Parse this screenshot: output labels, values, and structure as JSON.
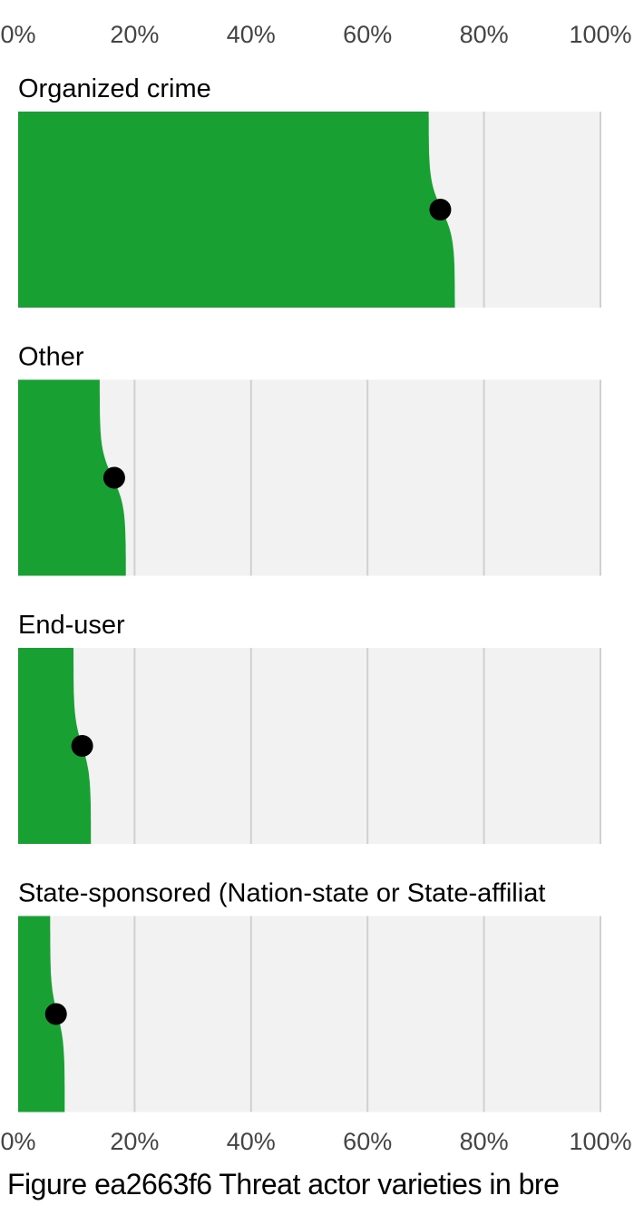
{
  "chart_data": {
    "type": "area",
    "x_ticks": [
      "0%",
      "20%",
      "40%",
      "60%",
      "80%",
      "100%"
    ],
    "xlim": [
      0,
      100
    ],
    "grid": true,
    "panels": [
      {
        "label": "Organized crime",
        "point": 72.5,
        "range": [
          70.5,
          75
        ]
      },
      {
        "label": "Other",
        "point": 16.5,
        "range": [
          14,
          18.5
        ]
      },
      {
        "label": "End-user",
        "point": 11,
        "range": [
          9.5,
          12.5
        ]
      },
      {
        "label": "State-sponsored (Nation-state or State-affiliat",
        "point": 6.5,
        "range": [
          5.5,
          8
        ]
      }
    ]
  },
  "caption": "Figure ea2663f6 Threat actor varieties in bre",
  "colors": {
    "fill": "#18a033",
    "panel_bg": "#f2f2f2",
    "grid": "#d0d0d0",
    "point": "#000000",
    "tick_text": "#444444"
  }
}
